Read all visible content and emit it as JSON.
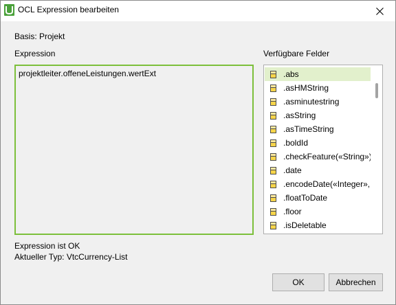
{
  "window": {
    "title": "OCL Expression bearbeiten",
    "accent_color": "#7cbf3a",
    "selection_color": "#e2f0cc"
  },
  "basis": {
    "text": "Basis: Projekt"
  },
  "expression": {
    "label": "Expression",
    "value": "projektleiter.offeneLeistungen.wertExt"
  },
  "fields": {
    "label": "Verfügbare Felder",
    "selected_index": 0,
    "items": [
      {
        "label": ".abs"
      },
      {
        "label": ".asHMString"
      },
      {
        "label": ".asminutestring"
      },
      {
        "label": ".asString"
      },
      {
        "label": ".asTimeString"
      },
      {
        "label": ".boldId"
      },
      {
        "label": ".checkFeature(«String»)"
      },
      {
        "label": ".date"
      },
      {
        "label": ".encodeDate(«Integer»,..."
      },
      {
        "label": ".floatToDate"
      },
      {
        "label": ".floor"
      },
      {
        "label": ".isDeletable"
      }
    ]
  },
  "status": {
    "message": "Expression ist OK",
    "type": "Aktueller Typ: VtcCurrency-List"
  },
  "buttons": {
    "ok": "OK",
    "cancel": "Abbrechen"
  }
}
